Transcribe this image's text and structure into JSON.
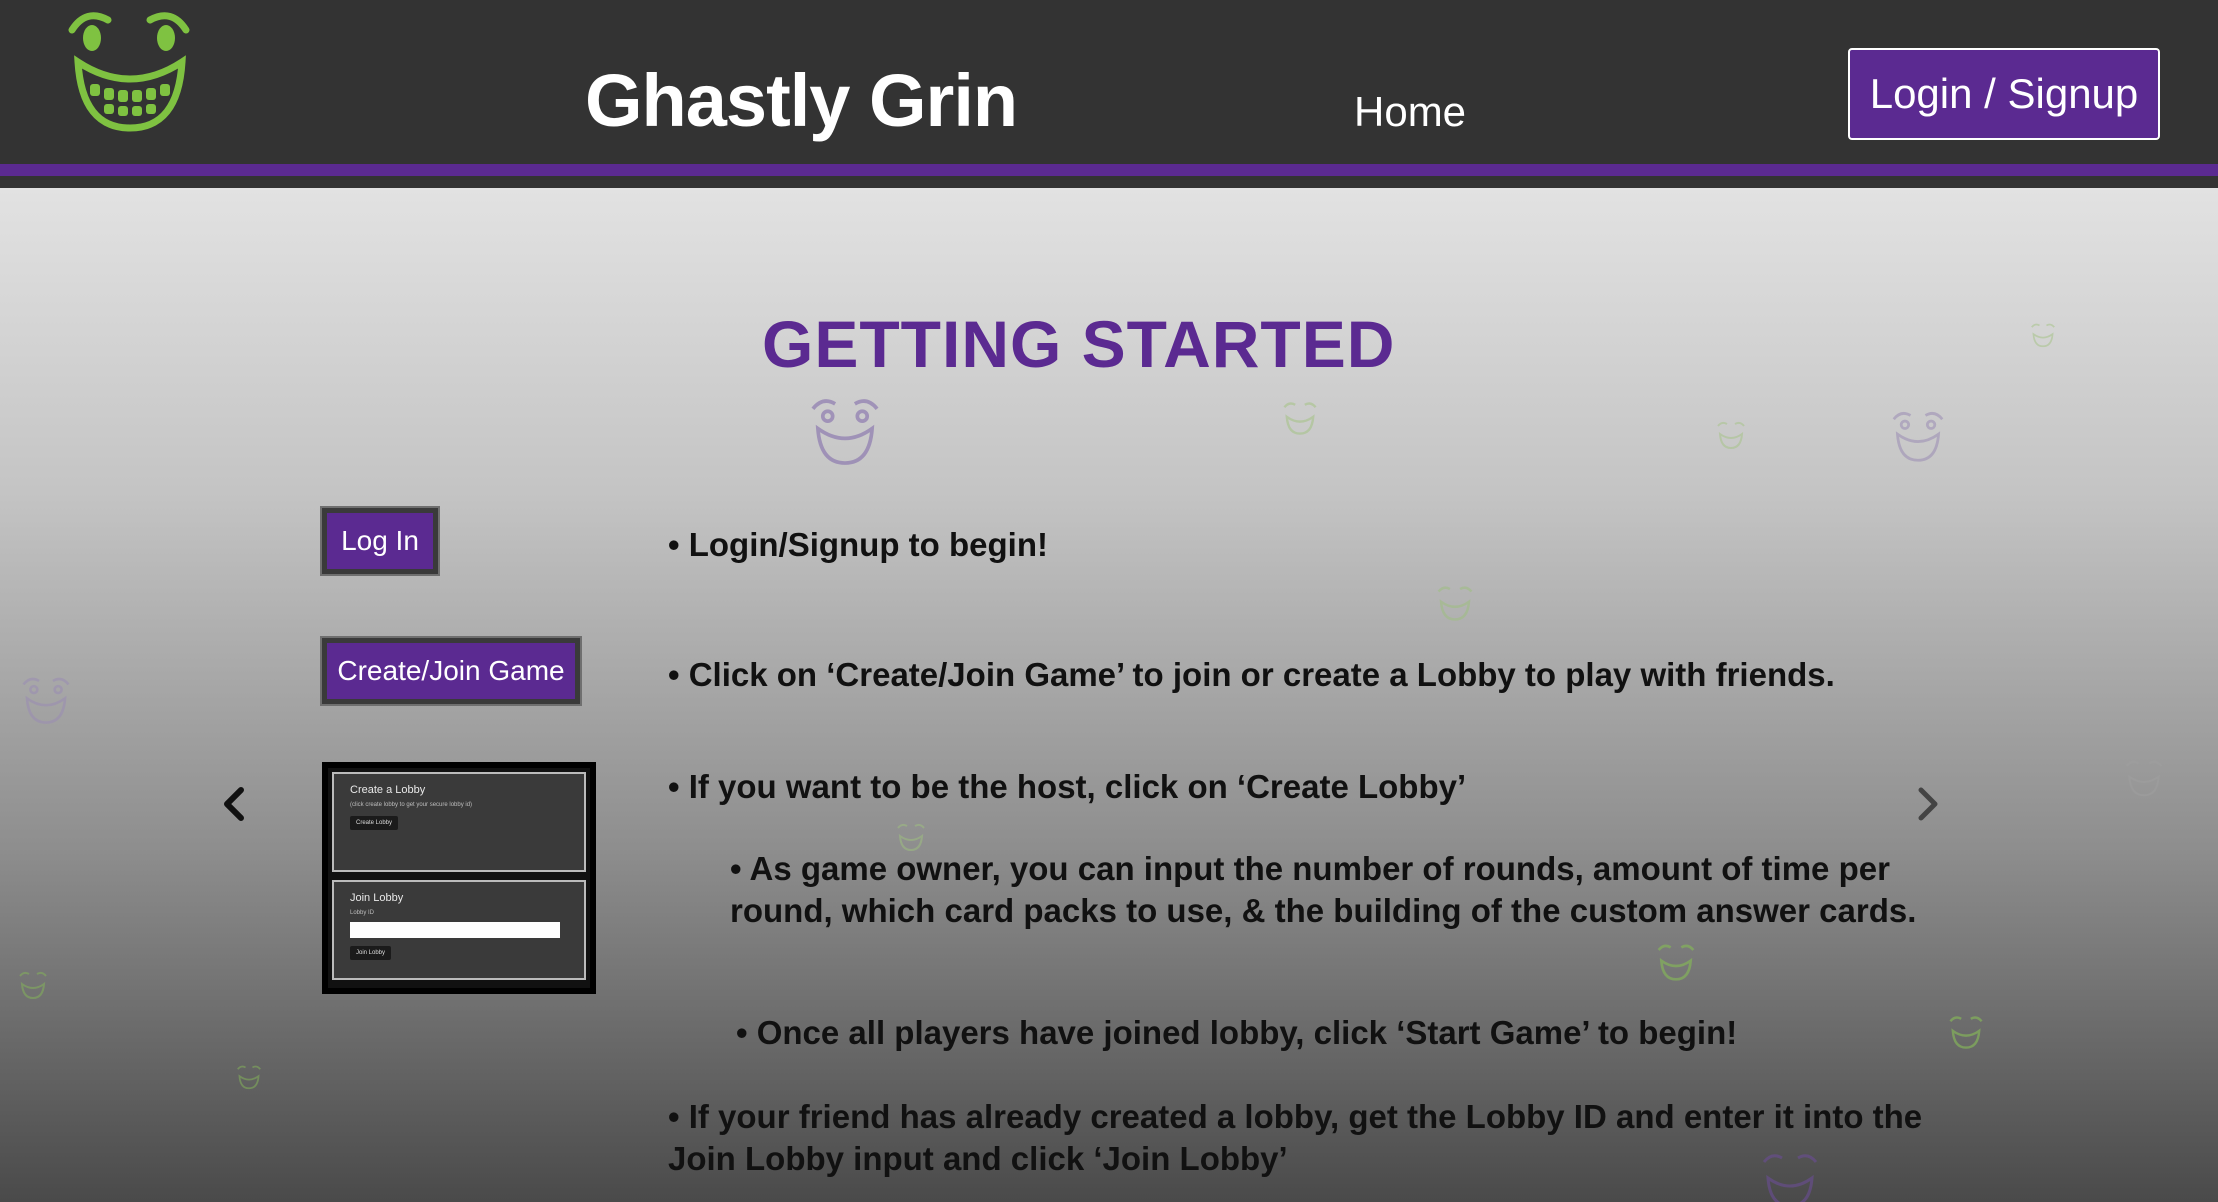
{
  "navbar": {
    "logo_icon": "grinning-face-logo",
    "brand": "Ghastly Grin",
    "home_link": "Home",
    "login_button": "Login / Signup",
    "accent_color": "#5b2a91",
    "logo_color": "#7fc241"
  },
  "main": {
    "title": "GETTING STARTED",
    "carousel": {
      "prev_icon": "chevron-left-icon",
      "next_icon": "chevron-right-icon"
    },
    "demo_login_button": "Log In",
    "demo_create_button": "Create/Join Game",
    "demo_screenshot": {
      "create_title": "Create a Lobby",
      "create_sub": "(click create lobby to get your secure lobby id)",
      "create_button": "Create Lobby",
      "join_title": "Join Lobby",
      "join_label": "Lobby ID",
      "join_button": "Join Lobby"
    },
    "steps": [
      "• Login/Signup to begin!",
      "• Click on ‘Create/Join Game’ to join or create a Lobby to play with friends.",
      "• If you want to be the host, click on ‘Create Lobby’",
      "• As game owner, you can input the number of rounds, amount of time per round, which card packs to use, & the building of the custom answer cards.",
      "• Once all players have joined lobby, click ‘Start Game’ to begin!",
      "• If your friend has already created a lobby, get the Lobby ID and enter it into the Join Lobby input and click ‘Join Lobby’"
    ]
  }
}
